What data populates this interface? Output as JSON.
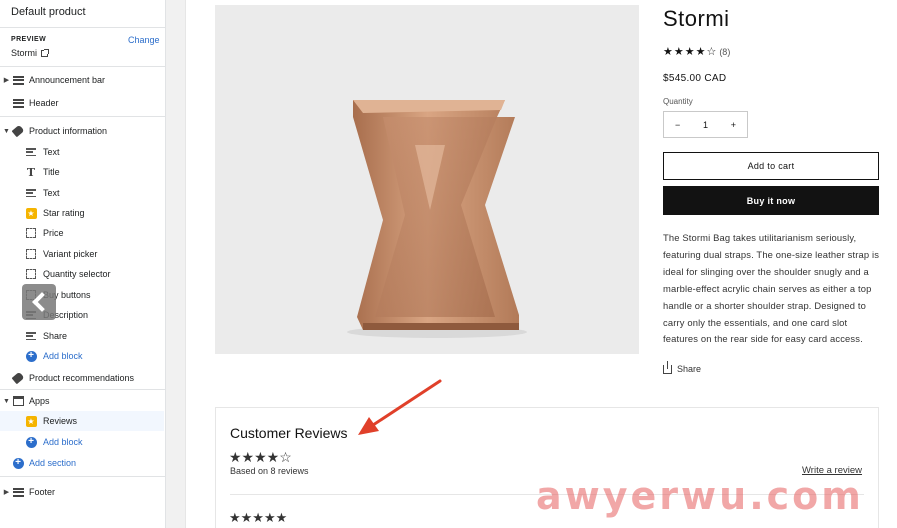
{
  "sidebar": {
    "title": "Default product",
    "preview": {
      "label": "PREVIEW",
      "change": "Change",
      "value": "Stormi"
    },
    "items": [
      {
        "label": "Announcement bar",
        "icon": "bars-icon"
      },
      {
        "label": "Header",
        "icon": "bars-icon"
      },
      {
        "label": "Product information",
        "icon": "tag-icon"
      },
      {
        "label": "Text",
        "icon": "text-icon"
      },
      {
        "label": "Title",
        "icon": "title-icon"
      },
      {
        "label": "Text",
        "icon": "text-icon"
      },
      {
        "label": "Star rating",
        "icon": "star-icon"
      },
      {
        "label": "Price",
        "icon": "frame-icon"
      },
      {
        "label": "Variant picker",
        "icon": "frame-icon"
      },
      {
        "label": "Quantity selector",
        "icon": "frame-icon"
      },
      {
        "label": "Buy buttons",
        "icon": "frame-icon"
      },
      {
        "label": "Description",
        "icon": "text-icon"
      },
      {
        "label": "Share",
        "icon": "text-icon"
      },
      {
        "label": "Add block",
        "icon": "plus-icon"
      },
      {
        "label": "Product recommendations",
        "icon": "tag-icon"
      },
      {
        "label": "Apps",
        "icon": "apps-icon"
      },
      {
        "label": "Reviews",
        "icon": "star-icon"
      },
      {
        "label": "Add block",
        "icon": "plus-icon"
      },
      {
        "label": "Add section",
        "icon": "plus-icon"
      },
      {
        "label": "Footer",
        "icon": "bars-icon"
      }
    ]
  },
  "product": {
    "title": "Stormi",
    "stars": "★★★★☆",
    "review_count": "(8)",
    "price": "$545.00 CAD",
    "quantity_label": "Quantity",
    "quantity_minus": "−",
    "quantity_value": "1",
    "quantity_plus": "+",
    "add_to_cart": "Add to cart",
    "buy_now": "Buy it now",
    "description": "The Stormi Bag takes utilitarianism seriously, featuring dual straps. The one-size leather strap is ideal for slinging over the shoulder snugly and a marble-effect acrylic chain serves as either a top handle or a shorter shoulder strap. Designed to carry only the essentials, and one card slot features on the rear side for easy card access.",
    "share": "Share"
  },
  "reviews": {
    "title": "Customer Reviews",
    "stars": "★★★★☆",
    "based_on": "Based on 8 reviews",
    "write_review": "Write a review",
    "first_review_stars": "★★★★★"
  },
  "watermark": "awyerwu.com",
  "colors": {
    "accent": "#2c6ecb",
    "star": "#f5b400",
    "annotation_arrow": "#e0402a",
    "product_fill": "#c28a65"
  }
}
